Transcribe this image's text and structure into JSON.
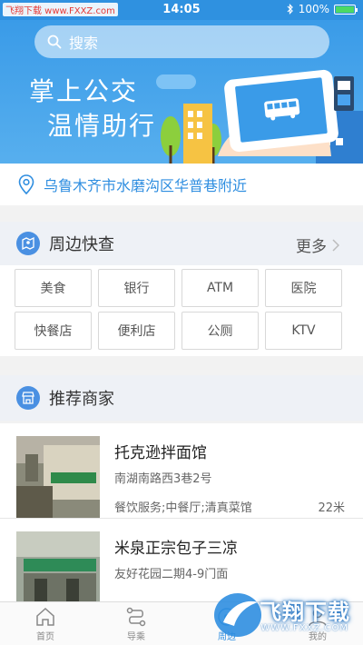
{
  "status_bar": {
    "watermark": "飞翔下载 www.FXXZ.com",
    "time": "14:05",
    "battery": "100%",
    "battery_level": 1.0
  },
  "banner": {
    "search_placeholder": "搜索",
    "slogan_line1": "掌上公交",
    "slogan_line2": "温情助行"
  },
  "location": {
    "text": "乌鲁木齐市水磨沟区华普巷附近"
  },
  "nearby": {
    "title": "周边快查",
    "more_label": "更多",
    "items": [
      "美食",
      "银行",
      "ATM",
      "医院",
      "快餐店",
      "便利店",
      "公厕",
      "KTV"
    ]
  },
  "recommend": {
    "title": "推荐商家",
    "merchants": [
      {
        "name": "托克逊拌面馆",
        "address": "南湖南路西3巷2号",
        "category": "餐饮服务;中餐厅;清真菜馆",
        "distance": "22米"
      },
      {
        "name": "米泉正宗包子三凉",
        "address": "友好花园二期4-9门面",
        "category": "",
        "distance": ""
      }
    ]
  },
  "tabbar": {
    "tabs": [
      {
        "label": "首页",
        "icon": "home-icon"
      },
      {
        "label": "导乘",
        "icon": "route-icon"
      },
      {
        "label": "周边",
        "icon": "nearby-icon"
      },
      {
        "label": "我的",
        "icon": "profile-icon"
      }
    ],
    "active_index": 2
  },
  "watermark_logo": {
    "text": "飞翔下载",
    "url": "WWW.FXXZ.COM"
  },
  "colors": {
    "primary": "#2f8ee0",
    "banner": "#3a9be8",
    "section_bg": "#eef1f6"
  }
}
